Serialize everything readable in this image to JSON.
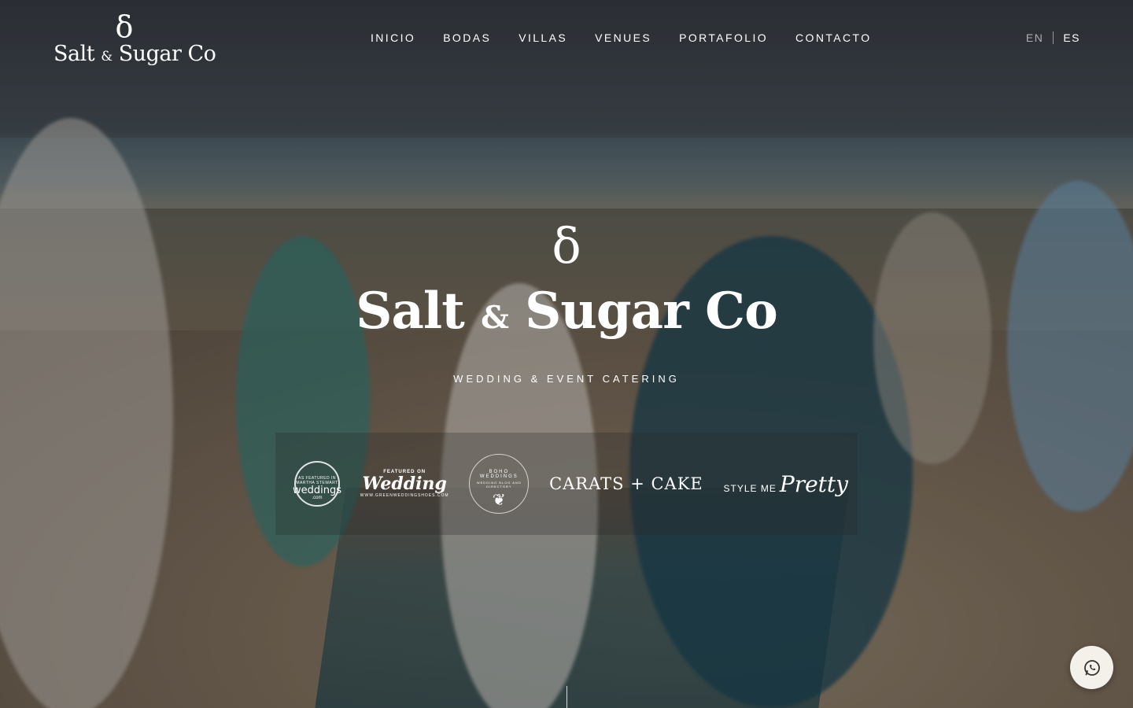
{
  "header": {
    "logo_mark": "δ",
    "logo_text_1": "Salt",
    "logo_amp": "&",
    "logo_text_2": "Sugar Co"
  },
  "nav": {
    "items": [
      {
        "label": "INICIO"
      },
      {
        "label": "BODAS"
      },
      {
        "label": "VILLAS"
      },
      {
        "label": "VENUES"
      },
      {
        "label": "PORTAFOLIO"
      },
      {
        "label": "CONTACTO"
      }
    ]
  },
  "language": {
    "en": "EN",
    "es": "ES"
  },
  "hero": {
    "mark": "δ",
    "title_1": "Salt",
    "title_amp": "&",
    "title_2": "Sugar Co",
    "subtitle": "WEDDING & EVENT CATERING"
  },
  "press": {
    "martha_stewart": {
      "line1": "AS FEATURED IN MARTHA STEWART",
      "line2": "weddings",
      "line3": ".com"
    },
    "green_wedding_shoes": {
      "line1": "FEATURED ON",
      "line2": "Wedding",
      "line3": "WWW.GREENWEDDINGSHOES.COM"
    },
    "boho_weddings": {
      "line1": "BOHO WEDDINGS",
      "line2": "WEDDING BLOG AND DIRECTORY",
      "line3": "❦"
    },
    "carats_cake": {
      "label": "CARATS + CAKE"
    },
    "style_me_pretty": {
      "line1": "STYLE ME",
      "line2": "Pretty"
    }
  },
  "whatsapp": {
    "icon": "whatsapp-icon"
  }
}
